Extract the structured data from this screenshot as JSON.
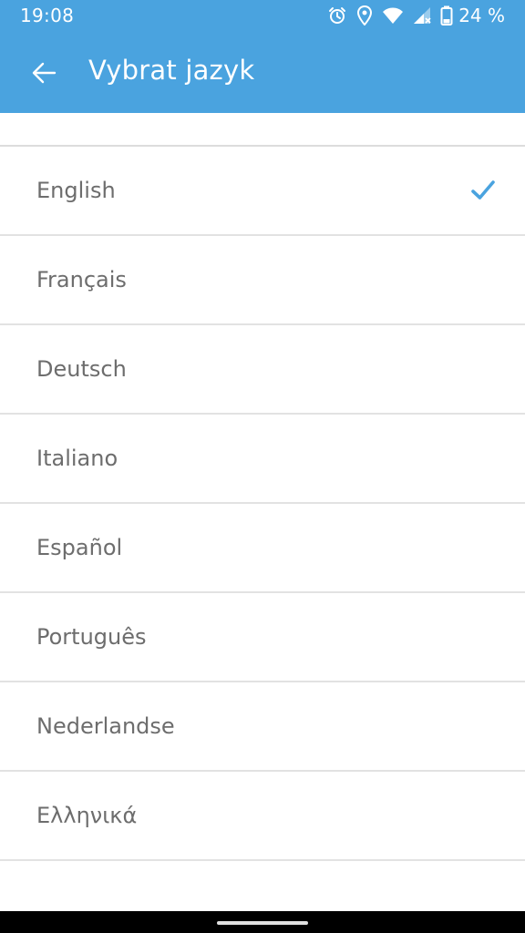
{
  "status_bar": {
    "time": "19:08",
    "battery": "24 %",
    "icons": [
      "alarm-icon",
      "location-icon",
      "wifi-icon",
      "signal-icon",
      "battery-icon"
    ]
  },
  "toolbar": {
    "title": "Vybrat jazyk",
    "back_icon": "arrow-left-icon"
  },
  "languages": {
    "items": [
      {
        "label": "English",
        "selected": true
      },
      {
        "label": "Français",
        "selected": false
      },
      {
        "label": "Deutsch",
        "selected": false
      },
      {
        "label": "Italiano",
        "selected": false
      },
      {
        "label": "Español",
        "selected": false
      },
      {
        "label": "Português",
        "selected": false
      },
      {
        "label": "Nederlandse",
        "selected": false
      },
      {
        "label": "Ελληνικά",
        "selected": false
      }
    ]
  },
  "colors": {
    "app_bar": "#4aa3df",
    "accent_check": "#4aa3df",
    "list_text": "#6d6d6d",
    "divider": "#e2e2e2"
  }
}
